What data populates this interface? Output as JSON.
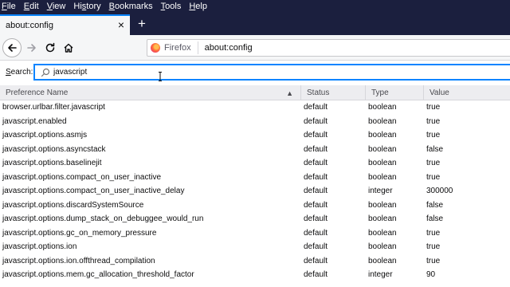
{
  "menu": [
    {
      "mnemonic": "F",
      "rest": "ile"
    },
    {
      "mnemonic": "E",
      "rest": "dit"
    },
    {
      "mnemonic": "V",
      "rest": "iew"
    },
    {
      "pre": "Hi",
      "mnemonic": "s",
      "rest": "tory"
    },
    {
      "mnemonic": "B",
      "rest": "ookmarks"
    },
    {
      "mnemonic": "T",
      "rest": "ools"
    },
    {
      "mnemonic": "H",
      "rest": "elp"
    }
  ],
  "tab": {
    "title": "about:config",
    "close_glyph": "×",
    "new_tab_glyph": "+"
  },
  "urlbar": {
    "brand": "Firefox",
    "url": "about:config"
  },
  "search": {
    "label_mnemonic": "S",
    "label_rest": "earch:",
    "value": "javascript"
  },
  "columns": {
    "name": "Preference Name",
    "status": "Status",
    "type": "Type",
    "value": "Value"
  },
  "rows": [
    {
      "name": "browser.urlbar.filter.javascript",
      "status": "default",
      "type": "boolean",
      "value": "true"
    },
    {
      "name": "javascript.enabled",
      "status": "default",
      "type": "boolean",
      "value": "true"
    },
    {
      "name": "javascript.options.asmjs",
      "status": "default",
      "type": "boolean",
      "value": "true"
    },
    {
      "name": "javascript.options.asyncstack",
      "status": "default",
      "type": "boolean",
      "value": "false"
    },
    {
      "name": "javascript.options.baselinejit",
      "status": "default",
      "type": "boolean",
      "value": "true"
    },
    {
      "name": "javascript.options.compact_on_user_inactive",
      "status": "default",
      "type": "boolean",
      "value": "true"
    },
    {
      "name": "javascript.options.compact_on_user_inactive_delay",
      "status": "default",
      "type": "integer",
      "value": "300000"
    },
    {
      "name": "javascript.options.discardSystemSource",
      "status": "default",
      "type": "boolean",
      "value": "false"
    },
    {
      "name": "javascript.options.dump_stack_on_debuggee_would_run",
      "status": "default",
      "type": "boolean",
      "value": "false"
    },
    {
      "name": "javascript.options.gc_on_memory_pressure",
      "status": "default",
      "type": "boolean",
      "value": "true"
    },
    {
      "name": "javascript.options.ion",
      "status": "default",
      "type": "boolean",
      "value": "true"
    },
    {
      "name": "javascript.options.ion.offthread_compilation",
      "status": "default",
      "type": "boolean",
      "value": "true"
    },
    {
      "name": "javascript.options.mem.gc_allocation_threshold_factor",
      "status": "default",
      "type": "integer",
      "value": "90"
    }
  ],
  "colors": {
    "menubar_bg": "#1b1f3e",
    "accent": "#0a84ff",
    "toolbar_bg": "#f5f6f7"
  }
}
